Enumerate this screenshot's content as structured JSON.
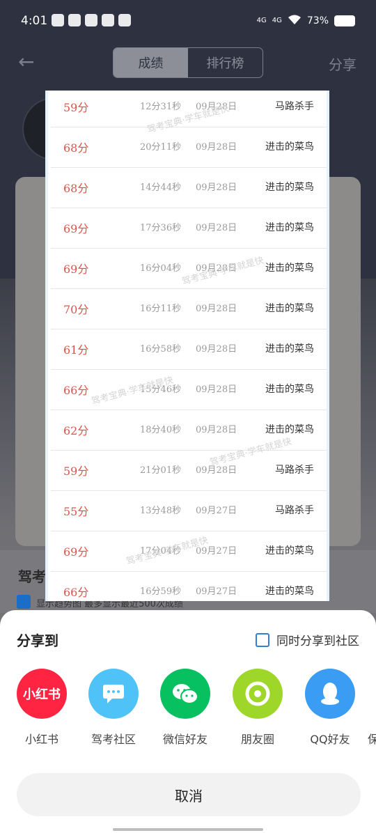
{
  "status": {
    "time": "4:01",
    "network1": "4G",
    "network2": "4G",
    "battery": "73%"
  },
  "nav": {
    "tabs": [
      "成绩",
      "排行榜"
    ],
    "share_label": "分享"
  },
  "background": {
    "section_title": "驾考",
    "note": "显示趋势图  最多显示最近500次成绩"
  },
  "results": [
    {
      "score": "59分",
      "duration": "12分31秒",
      "date": "09月28日",
      "title": "马路杀手"
    },
    {
      "score": "68分",
      "duration": "20分11秒",
      "date": "09月28日",
      "title": "进击的菜鸟"
    },
    {
      "score": "68分",
      "duration": "14分44秒",
      "date": "09月28日",
      "title": "进击的菜鸟"
    },
    {
      "score": "69分",
      "duration": "17分36秒",
      "date": "09月28日",
      "title": "进击的菜鸟"
    },
    {
      "score": "69分",
      "duration": "16分04秒",
      "date": "09月28日",
      "title": "进击的菜鸟"
    },
    {
      "score": "70分",
      "duration": "16分11秒",
      "date": "09月28日",
      "title": "进击的菜鸟"
    },
    {
      "score": "61分",
      "duration": "16分58秒",
      "date": "09月28日",
      "title": "进击的菜鸟"
    },
    {
      "score": "66分",
      "duration": "15分46秒",
      "date": "09月28日",
      "title": "进击的菜鸟"
    },
    {
      "score": "62分",
      "duration": "18分40秒",
      "date": "09月28日",
      "title": "进击的菜鸟"
    },
    {
      "score": "59分",
      "duration": "21分01秒",
      "date": "09月28日",
      "title": "马路杀手"
    },
    {
      "score": "55分",
      "duration": "13分48秒",
      "date": "09月27日",
      "title": "马路杀手"
    },
    {
      "score": "69分",
      "duration": "17分04秒",
      "date": "09月27日",
      "title": "进击的菜鸟"
    },
    {
      "score": "66分",
      "duration": "16分59秒",
      "date": "09月27日",
      "title": "进击的菜鸟"
    }
  ],
  "watermark": "驾考宝典·学车就是快",
  "share": {
    "title": "分享到",
    "community_label": "同时分享到社区",
    "apps": [
      {
        "label": "小红书",
        "icon": "xiaohongshu-icon",
        "icon_text": "小红书",
        "color": "#ff2442"
      },
      {
        "label": "驾考社区",
        "icon": "community-chat-icon",
        "icon_text": "···",
        "color": "#4fc3f7"
      },
      {
        "label": "微信好友",
        "icon": "wechat-icon",
        "icon_text": "",
        "color": "#07c160"
      },
      {
        "label": "朋友圈",
        "icon": "moments-icon",
        "icon_text": "",
        "color": "#9ed62a"
      },
      {
        "label": "QQ好友",
        "icon": "qq-icon",
        "icon_text": "",
        "color": "#3a9cf2"
      },
      {
        "label": "保",
        "icon": "more-icon",
        "icon_text": "",
        "color": "#ffffff"
      }
    ],
    "cancel_label": "取消"
  }
}
